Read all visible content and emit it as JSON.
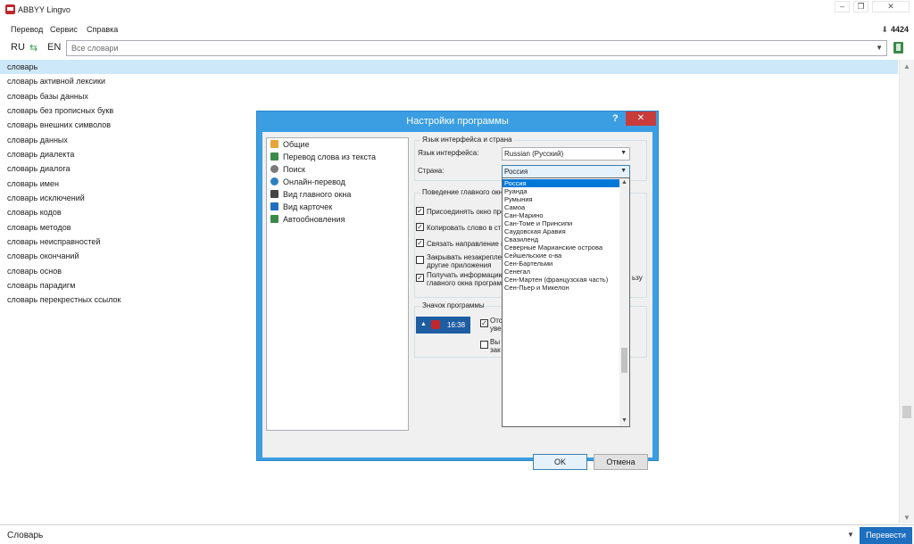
{
  "app": {
    "title": "ABBYY Lingvo",
    "counter": "4424"
  },
  "menu": [
    "Перевод",
    "Сервис",
    "Справка"
  ],
  "search": {
    "from_lang": "RU",
    "to_lang": "EN",
    "placeholder": "Все словари"
  },
  "words": [
    "словарь",
    "словарь активной лексики",
    "словарь базы данных",
    "словарь без прописных букв",
    "словарь внешних символов",
    "словарь данных",
    "словарь диалекта",
    "словарь диалога",
    "словарь имен",
    "словарь исключений",
    "словарь кодов",
    "словарь методов",
    "словарь неисправностей",
    "словарь окончаний",
    "словарь основ",
    "словарь парадигм",
    "словарь перекрестных ссылок"
  ],
  "bottom": {
    "input_value": "Словарь",
    "translate_button": "Перевести"
  },
  "dialog": {
    "title": "Настройки программы",
    "help": "?",
    "tree": [
      {
        "label": "Общие",
        "icon": "folder-icon",
        "color": "#e8a33a"
      },
      {
        "label": "Перевод слова из текста",
        "icon": "document-icon",
        "color": "#3a8a4a"
      },
      {
        "label": "Поиск",
        "icon": "search-icon",
        "color": "#7a7a7a"
      },
      {
        "label": "Онлайн-перевод",
        "icon": "globe-icon",
        "color": "#2f7fc1"
      },
      {
        "label": "Вид главного окна",
        "icon": "window-icon",
        "color": "#444444"
      },
      {
        "label": "Вид карточек",
        "icon": "cards-icon",
        "color": "#1e6fbf"
      },
      {
        "label": "Автообновления",
        "icon": "update-icon",
        "color": "#3a8a4a"
      }
    ],
    "group_language": "Язык интерфейса и страна",
    "interface_language_label": "Язык интерфейса:",
    "interface_language_value": "Russian (Русский)",
    "country_label": "Страна:",
    "country_value": "Россия",
    "group_behavior": "Поведение главного окна",
    "checkboxes": [
      {
        "label": "Присоединять окно про",
        "checked": true
      },
      {
        "label": "Копировать слово в стр",
        "checked": true
      },
      {
        "label": "Связать направление п",
        "checked": true
      },
      {
        "label": "Закрывать незакрепле",
        "label2": "другие приложения",
        "checked": false
      },
      {
        "label": "Получать информацию",
        "label2": "главного окна програм",
        "tail": "ьзу",
        "checked": true
      }
    ],
    "group_icon": "Значок программы",
    "tray_time": "16:38",
    "icon_checkboxes": [
      {
        "label": "Отс",
        "label2": "уве",
        "checked": true
      },
      {
        "label": "Вы",
        "label2": "зак",
        "checked": false
      }
    ],
    "ok": "OK",
    "cancel": "Отмена"
  },
  "country_dropdown": [
    "Россия",
    "Руанда",
    "Румыния",
    "Самоа",
    "Сан-Марино",
    "Сан-Томе и Принсипи",
    "Саудовская Аравия",
    "Свазиленд",
    "Северные Марианские острова",
    "Сейшельские о-ва",
    "Сен-Бартельми",
    "Сенегал",
    "Сен-Мартен (французская часть)",
    "Сен-Пьер и Микелон"
  ]
}
